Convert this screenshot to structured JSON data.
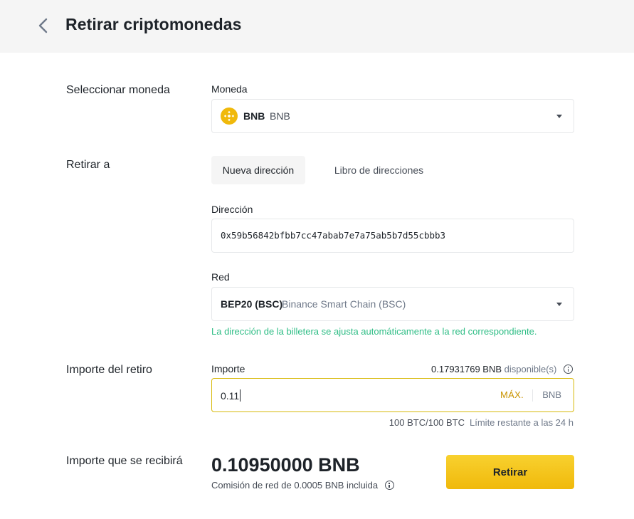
{
  "header": {
    "title": "Retirar criptomonedas"
  },
  "coin_section": {
    "row_label": "Seleccionar moneda",
    "field_label": "Moneda",
    "selected_symbol": "BNB",
    "selected_name": "BNB"
  },
  "destination": {
    "row_label": "Retirar a",
    "tabs": [
      "Nueva dirección",
      "Libro de direcciones"
    ],
    "address_label": "Dirección",
    "address_value": "0x59b56842bfbb7cc47abab7e7a75ab5b7d55cbbb3",
    "network_label": "Red",
    "network_code": "BEP20 (BSC)",
    "network_name": "Binance Smart Chain (BSC)",
    "network_hint": "La dirección de la billetera se ajusta automáticamente a la red correspondiente."
  },
  "amount": {
    "row_label": "Importe del retiro",
    "field_label": "Importe",
    "available_value": "0.17931769 BNB",
    "available_label": "disponible(s)",
    "input_value": "0.11",
    "max_label": "MÁX.",
    "unit": "BNB",
    "limit_value": "100 BTC/100 BTC",
    "limit_label": "Límite restante a las 24 h"
  },
  "receive": {
    "row_label": "Importe que se recibirá",
    "amount": "0.10950000 BNB",
    "fee_note": "Comisión de red de 0.0005 BNB incluida",
    "withdraw_button": "Retirar"
  },
  "colors": {
    "accent": "#f0b90b",
    "hint_green": "#2ebd85",
    "header_bg": "#f5f5f5"
  }
}
